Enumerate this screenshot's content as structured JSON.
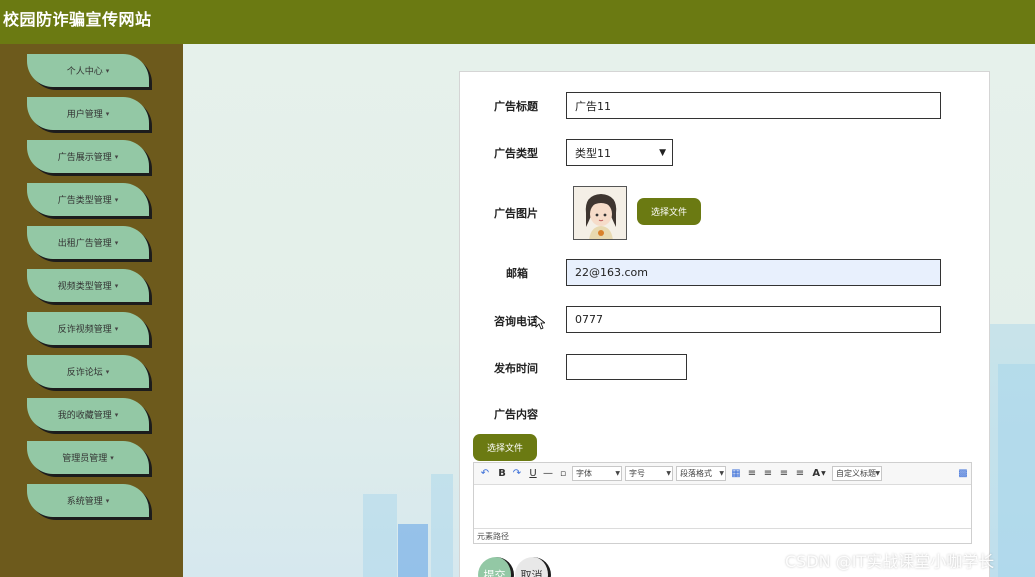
{
  "header": {
    "site_title": "校园防诈骗宣传网站"
  },
  "sidebar": {
    "items": [
      {
        "label": "个人中心"
      },
      {
        "label": "用户管理"
      },
      {
        "label": "广告展示管理"
      },
      {
        "label": "广告类型管理"
      },
      {
        "label": "出租广告管理"
      },
      {
        "label": "视频类型管理"
      },
      {
        "label": "反诈视频管理"
      },
      {
        "label": "反诈论坛"
      },
      {
        "label": "我的收藏管理"
      },
      {
        "label": "管理员管理"
      },
      {
        "label": "系统管理"
      }
    ],
    "caret": "▾"
  },
  "form": {
    "ad_title": {
      "label": "广告标题",
      "value": "广告11"
    },
    "ad_type": {
      "label": "广告类型",
      "value": "类型11"
    },
    "ad_image": {
      "label": "广告图片",
      "button": "选择文件"
    },
    "email": {
      "label": "邮箱",
      "value": "22@163.com"
    },
    "phone": {
      "label": "咨询电话",
      "value": "0777"
    },
    "publish_time": {
      "label": "发布时间",
      "value": ""
    },
    "content": {
      "label": "广告内容",
      "button": "选择文件"
    }
  },
  "editor": {
    "toolbar": {
      "font_family": "字体",
      "font_size": "字号",
      "paragraph": "段落格式",
      "custom_title": "自定义标题",
      "bold": "B",
      "italic": "I",
      "underline": "U",
      "font_color": "A"
    },
    "element_path": "元素路径"
  },
  "buttons": {
    "submit": "提交",
    "cancel": "取消"
  },
  "watermark": "CSDN @IT实战课堂小咖学长",
  "colors": {
    "header": "#6b7a12",
    "sidebar": "#6d5a1c",
    "nav_item": "#93c8a5",
    "button": "#6b7a12"
  }
}
